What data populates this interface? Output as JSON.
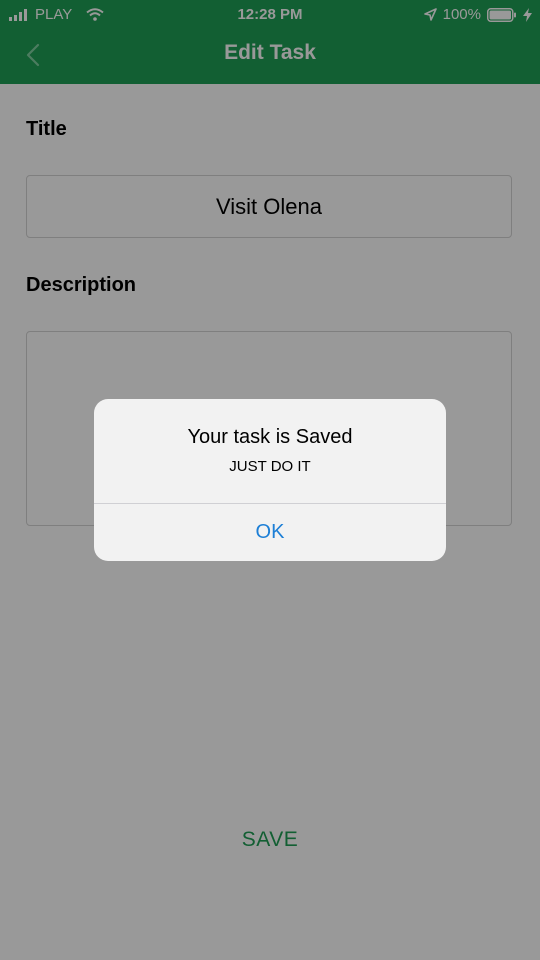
{
  "status_bar": {
    "carrier": "PLAY",
    "time": "12:28 PM",
    "battery": "100%"
  },
  "nav": {
    "title": "Edit Task"
  },
  "form": {
    "title_label": "Title",
    "title_value": "Visit Olena",
    "description_label": "Description",
    "description_value": "",
    "save_label": "SAVE"
  },
  "alert": {
    "title": "Your task is Saved",
    "message": "JUST DO IT",
    "ok_label": "OK"
  },
  "colors": {
    "header": "#1f9e55",
    "accent": "#1f9e55",
    "alert_button": "#1d7fd6"
  },
  "icons": {
    "status": [
      "signal-icon",
      "wifi-icon",
      "location-icon",
      "battery-icon",
      "bolt-icon"
    ],
    "nav": [
      "back-chevron-icon"
    ]
  }
}
